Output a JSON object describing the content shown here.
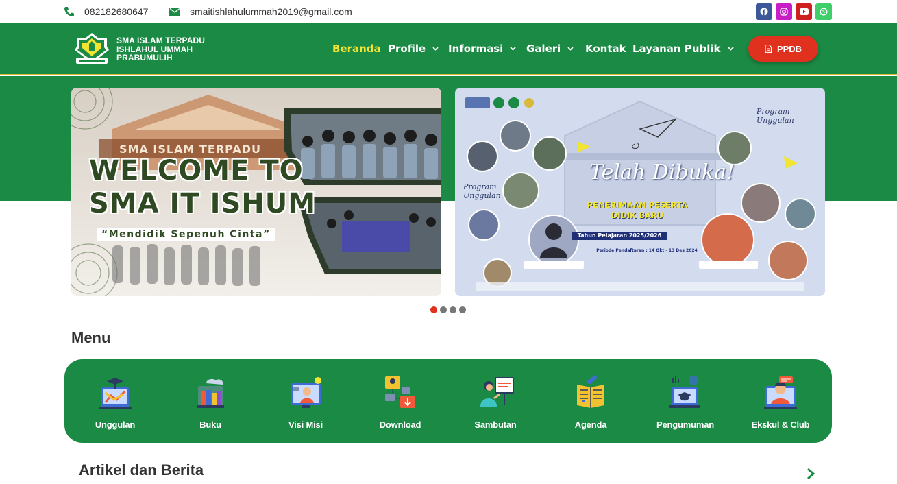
{
  "topbar": {
    "phone": "082182680647",
    "email": "smaitishlahulummah2019@gmail.com",
    "social": [
      {
        "icon": "facebook-icon",
        "color": "#3b5998"
      },
      {
        "icon": "instagram-icon",
        "color": "#c71ec5"
      },
      {
        "icon": "youtube-icon",
        "color": "#cd201f"
      },
      {
        "icon": "whatsapp-icon",
        "color": "#3ecf6a"
      }
    ]
  },
  "header": {
    "school_line1": "SMA ISLAM TERPADU",
    "school_line2": "ISHLAHUL UMMAH",
    "school_line3": "PRABUMULIH",
    "nav": {
      "beranda": "Beranda",
      "profile": "Profile",
      "informasi": "Informasi",
      "galeri": "Galeri",
      "kontak": "Kontak",
      "layanan": "Layanan Publik"
    },
    "ppdb_label": "PPDB"
  },
  "slider": {
    "slide1": {
      "banner_line1": "SMA ISLAM TERPADU",
      "welcome_line1": "WELCOME TO",
      "welcome_line2": "SMA IT ISHUM",
      "tagline": "“Mendidik Sepenuh Cinta”"
    },
    "slide2": {
      "headline": "Telah Dibuka!",
      "program_label": "Program Unggulan",
      "ppdb_line1": "PENERIMAAN PESERTA",
      "ppdb_line2": "DIDIK BARU",
      "tahun": "Tahun Pelajaran 2025/2026",
      "periode": "Periode Pendaftaran : 14 Okt - 13 Des 2024"
    },
    "active_dot": 1,
    "dot_count": 4
  },
  "menu": {
    "title": "Menu",
    "items": [
      {
        "label": "Unggulan",
        "icon": "unggulan-icon"
      },
      {
        "label": "Buku",
        "icon": "books-icon"
      },
      {
        "label": "Visi Misi",
        "icon": "visi-misi-icon"
      },
      {
        "label": "Download",
        "icon": "download-icon"
      },
      {
        "label": "Sambutan",
        "icon": "sambutan-icon"
      },
      {
        "label": "Agenda",
        "icon": "agenda-icon"
      },
      {
        "label": "Pengumuman",
        "icon": "pengumuman-icon"
      },
      {
        "label": "Ekskul & Club",
        "icon": "ekskul-icon"
      }
    ]
  },
  "artikel": {
    "title": "Artikel dan Berita"
  },
  "colors": {
    "brand_green": "#1b8a44",
    "accent_yellow": "#f2e433",
    "ppdb_red": "#e0301e"
  }
}
